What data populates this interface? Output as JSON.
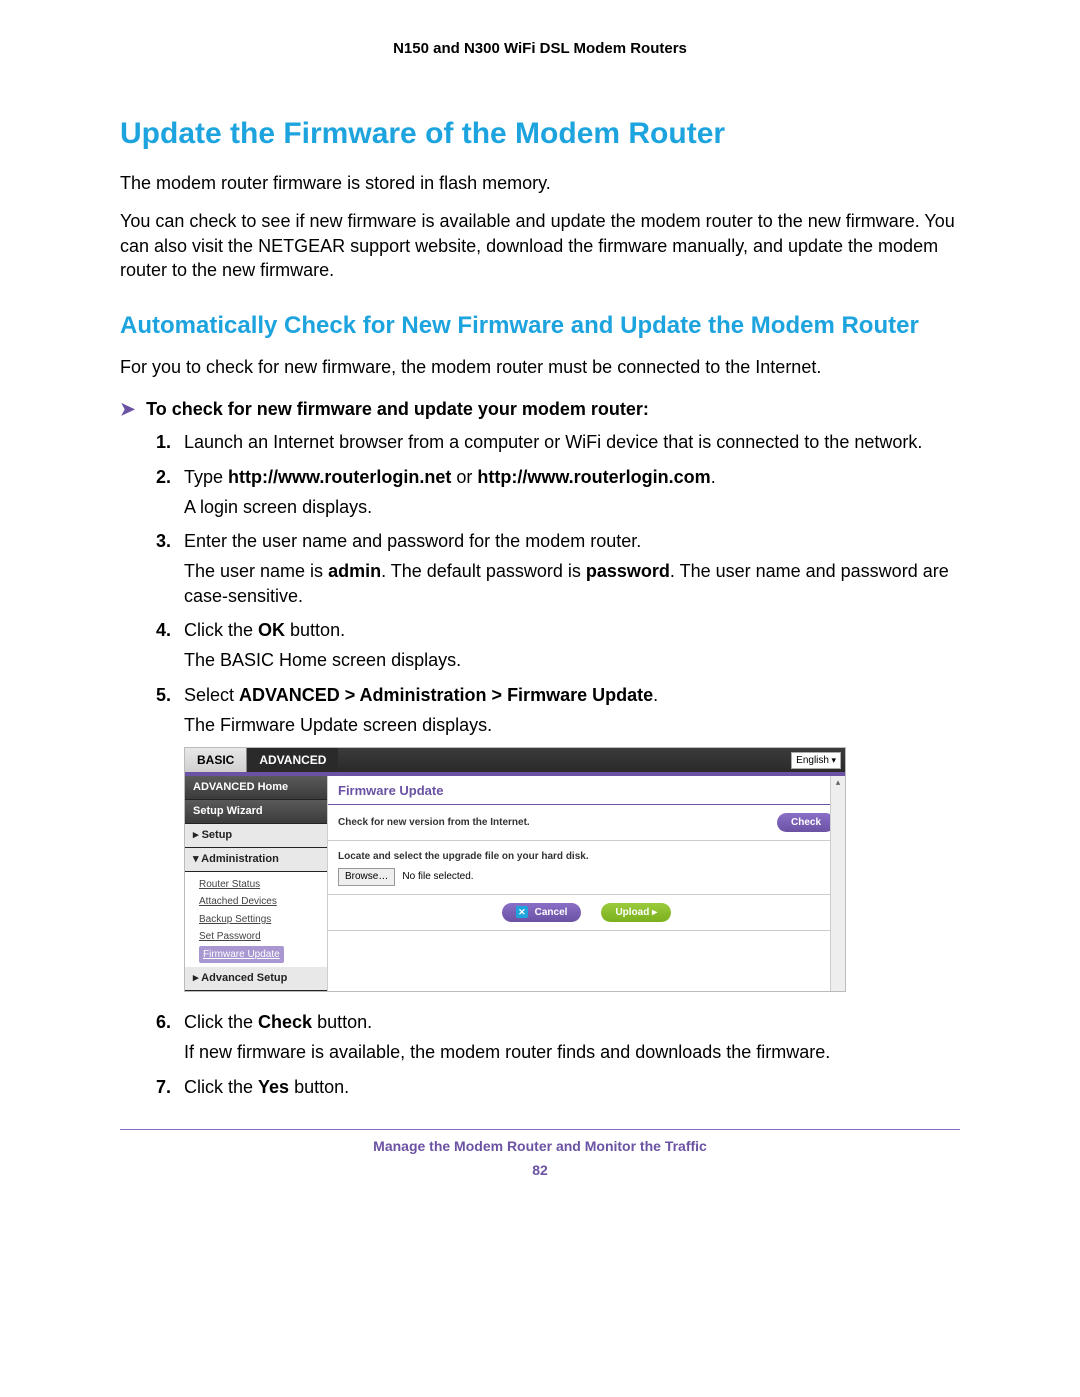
{
  "header": "N150 and N300 WiFi DSL Modem Routers",
  "title": "Update the Firmware of the Modem Router",
  "intro1": "The modem router firmware is stored in flash memory.",
  "intro2": "You can check to see if new firmware is available and update the modem router to the new firmware. You can also visit the NETGEAR support website, download the firmware manually, and update the modem router to the new firmware.",
  "subtitle": "Automatically Check for New Firmware and Update the Modem Router",
  "subintro": "For you to check for new firmware, the modem router must be connected to the Internet.",
  "proc_lead": "To check for new firmware and update your modem router:",
  "steps": {
    "s1": "Launch an Internet browser from a computer or WiFi device that is connected to the network.",
    "s2a": "Type ",
    "s2b": "http://www.routerlogin.net",
    "s2c": " or ",
    "s2d": "http://www.routerlogin.com",
    "s2e": ".",
    "s2sub": "A login screen displays.",
    "s3": "Enter the user name and password for the modem router.",
    "s3sub_a": "The user name is ",
    "s3sub_b": "admin",
    "s3sub_c": ". The default password is ",
    "s3sub_d": "password",
    "s3sub_e": ". The user name and password are case-sensitive.",
    "s4a": "Click the ",
    "s4b": "OK",
    "s4c": " button.",
    "s4sub": "The BASIC Home screen displays.",
    "s5a": "Select ",
    "s5b": "ADVANCED > Administration > Firmware Update",
    "s5c": ".",
    "s5sub": "The Firmware Update screen displays.",
    "s6a": "Click the ",
    "s6b": "Check",
    "s6c": " button.",
    "s6sub": "If new firmware is available, the modem router finds and downloads the firmware.",
    "s7a": "Click the ",
    "s7b": "Yes",
    "s7c": " button."
  },
  "ui": {
    "tab_basic": "BASIC",
    "tab_advanced": "ADVANCED",
    "lang": "English",
    "side": {
      "adv_home": "ADVANCED Home",
      "setup_wizard": "Setup Wizard",
      "setup": "▸ Setup",
      "admin": "▾ Administration",
      "items": {
        "router_status": "Router Status",
        "attached": "Attached Devices",
        "backup": "Backup Settings",
        "setpw": "Set Password",
        "fw": "Firmware Update"
      },
      "adv_setup": "▸ Advanced Setup"
    },
    "panel_title": "Firmware Update",
    "check_label": "Check for new version from the Internet.",
    "check_btn": "Check",
    "locate_label": "Locate and select the upgrade file on your hard disk.",
    "browse": "Browse…",
    "nofile": "No file selected.",
    "cancel": "Cancel",
    "upload": "Upload  ▸"
  },
  "footer": "Manage the Modem Router and Monitor the Traffic",
  "page_no": "82"
}
